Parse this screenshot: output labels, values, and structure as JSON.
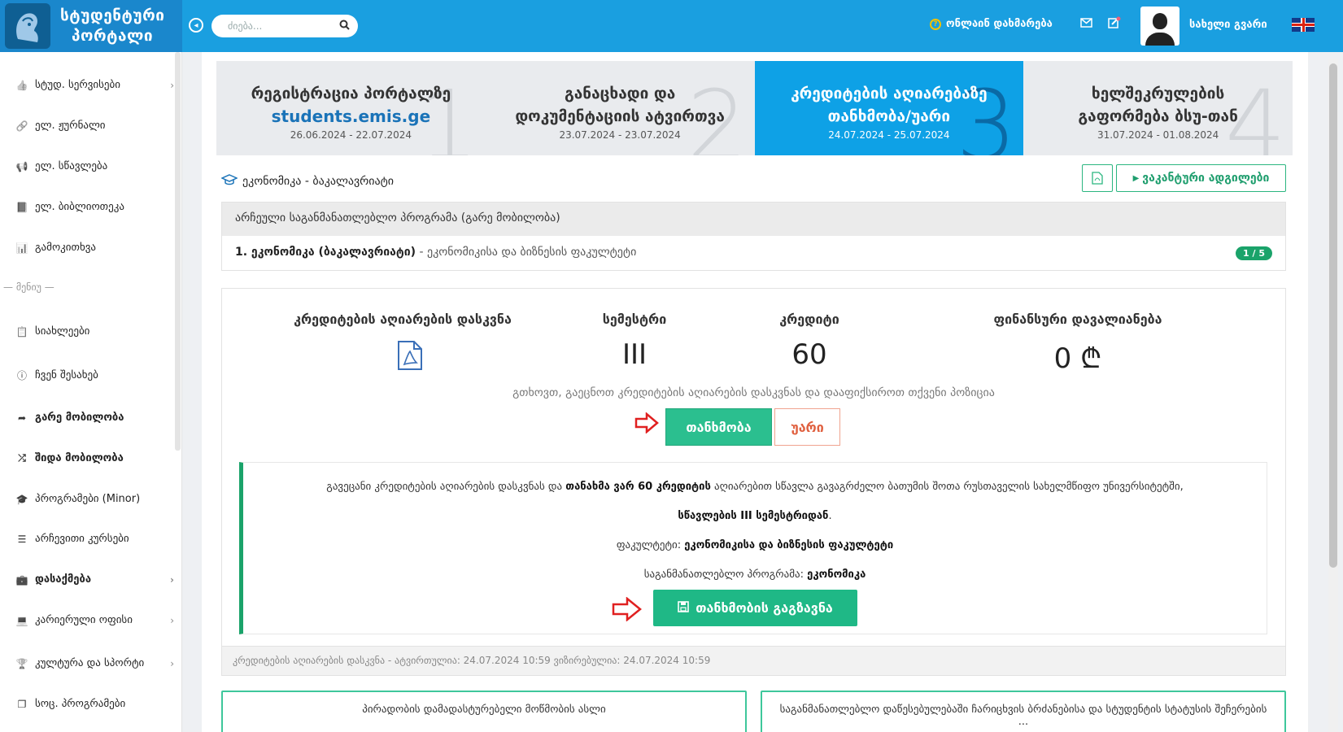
{
  "header": {
    "logo_line1": "სტუდენტური",
    "logo_line2": "პორტალი",
    "search_placeholder": "ძიება...",
    "help_label": "ონლაინ დახმარება",
    "user_name": "სახელი გვარი"
  },
  "sidebar": {
    "items": [
      {
        "label": "სტუდ. სერვისები",
        "icon": "thumbs-up-icon",
        "has_chevron": true,
        "bold": false
      },
      {
        "label": "ელ. ჟურნალი",
        "icon": "link-icon",
        "has_chevron": false,
        "bold": false
      },
      {
        "label": "ელ. სწავლება",
        "icon": "megaphone-icon",
        "has_chevron": false,
        "bold": false
      },
      {
        "label": "ელ. ბიბლიოთეკა",
        "icon": "book-icon",
        "has_chevron": false,
        "bold": false
      },
      {
        "label": "გამოკითხვა",
        "icon": "bar-chart-icon",
        "has_chevron": false,
        "bold": false
      },
      {
        "label": "სიახლეები",
        "icon": "clipboard-icon",
        "has_chevron": false,
        "bold": false
      },
      {
        "label": "ჩვენ შესახებ",
        "icon": "info-icon",
        "has_chevron": false,
        "bold": false
      },
      {
        "label": "გარე მობილობა",
        "icon": "share-arrow-icon",
        "has_chevron": false,
        "bold": true
      },
      {
        "label": "შიდა მობილობა",
        "icon": "shuffle-icon",
        "has_chevron": false,
        "bold": true
      },
      {
        "label": "პროგრამები (Minor)",
        "icon": "graduation-cap-icon",
        "has_chevron": false,
        "bold": false
      },
      {
        "label": "არჩევითი კურსები",
        "icon": "database-icon",
        "has_chevron": false,
        "bold": false
      },
      {
        "label": "დასაქმება",
        "icon": "briefcase-icon",
        "has_chevron": true,
        "bold": true
      },
      {
        "label": "კარიერული ოფისი",
        "icon": "laptop-icon",
        "has_chevron": true,
        "bold": false
      },
      {
        "label": "კულტურა და სპორტი",
        "icon": "trophy-icon",
        "has_chevron": true,
        "bold": false
      },
      {
        "label": "სოც. პროგრამები",
        "icon": "copy-icon",
        "has_chevron": false,
        "bold": false
      }
    ],
    "divider_label": "— მენიუ —"
  },
  "steps": [
    {
      "title": "რეგისტრაცია პორტალზე",
      "link": "students.emis.ge",
      "dates": "26.06.2024 - 22.07.2024",
      "num": "1",
      "active": false
    },
    {
      "title": "განაცხადი და დოკუმენტაციის ატვირთვა",
      "link": "",
      "dates": "23.07.2024 - 23.07.2024",
      "num": "2",
      "active": false
    },
    {
      "title": "კრედიტების აღიარებაზე თანხმობა/უარი",
      "link": "",
      "dates": "24.07.2024 - 25.07.2024",
      "num": "3",
      "active": true
    },
    {
      "title": "ხელშეკრულების გაფორმება ბსუ-თან",
      "link": "",
      "dates": "31.07.2024 - 01.08.2024",
      "num": "4",
      "active": false
    }
  ],
  "program": {
    "title": "ეკონომიკა - ბაკალავრიატი",
    "vacancy_button": "ვაკანტური ადგილები",
    "chosen_header": "არჩეული საგანმანათლებლო პროგრამა (გარე მობილობა)",
    "chosen_name": "1. ეკონომიკა (ბაკალავრიატი)",
    "chosen_faculty": " - ეკონომიკისა და ბიზნესის ფაკულტეტი",
    "chosen_badge": "1 / 5"
  },
  "summary": {
    "conclusion_label": "კრედიტების აღიარების დასკვნა",
    "semester_label": "სემესტრი",
    "semester_value": "III",
    "credits_label": "კრედიტი",
    "credits_value": "60",
    "debt_label": "ფინანსური დავალიანება",
    "debt_value": "0 ₾",
    "please_text": "გთხოვთ, გაეცნოთ კრედიტების აღიარების დასკვნას და დააფიქსიროთ თქვენი პოზიცია",
    "agree_button": "თანხმობა",
    "reject_button": "უარი"
  },
  "confirmation": {
    "line1_a": "გავეცანი კრედიტების აღიარების დასკვნას და ",
    "line1_b": "თანახმა ვარ 60 კრედიტის",
    "line1_c": " აღიარებით სწავლა გავაგრძელო ბათუმის შოთა რუსთაველის სახელმწიფო უნივერსიტეტში,",
    "line2": "სწავლების III სემესტრიდან",
    "line2_end": ".",
    "faculty_label": "ფაკულტეტი: ",
    "faculty_value": "ეკონომიკისა და ბიზნესის ფაკულტეტი",
    "program_label": "საგანმანათლებლო პროგრამა: ",
    "program_value": "ეკონომიკა",
    "send_button": "თანხმობის გაგზავნა"
  },
  "footer_note": "კრედიტების აღიარების დასკვნა - ატვირთულია: 24.07.2024 10:59 ვიზირებულია: 24.07.2024 10:59",
  "documents": [
    {
      "label": "პირადობის დამადასტურებელი მოწმობის ასლი"
    },
    {
      "label": "საგანმანათლებლო დაწესებულებაში ჩარიცხვის ბრძანებისა და სტუდენტის სტატუსის შეჩერების ..."
    }
  ],
  "colors": {
    "topbar": "#1a9fe0",
    "active_step": "#0ea1e6",
    "success": "#2bbf8f",
    "reject": "#e0603f"
  }
}
